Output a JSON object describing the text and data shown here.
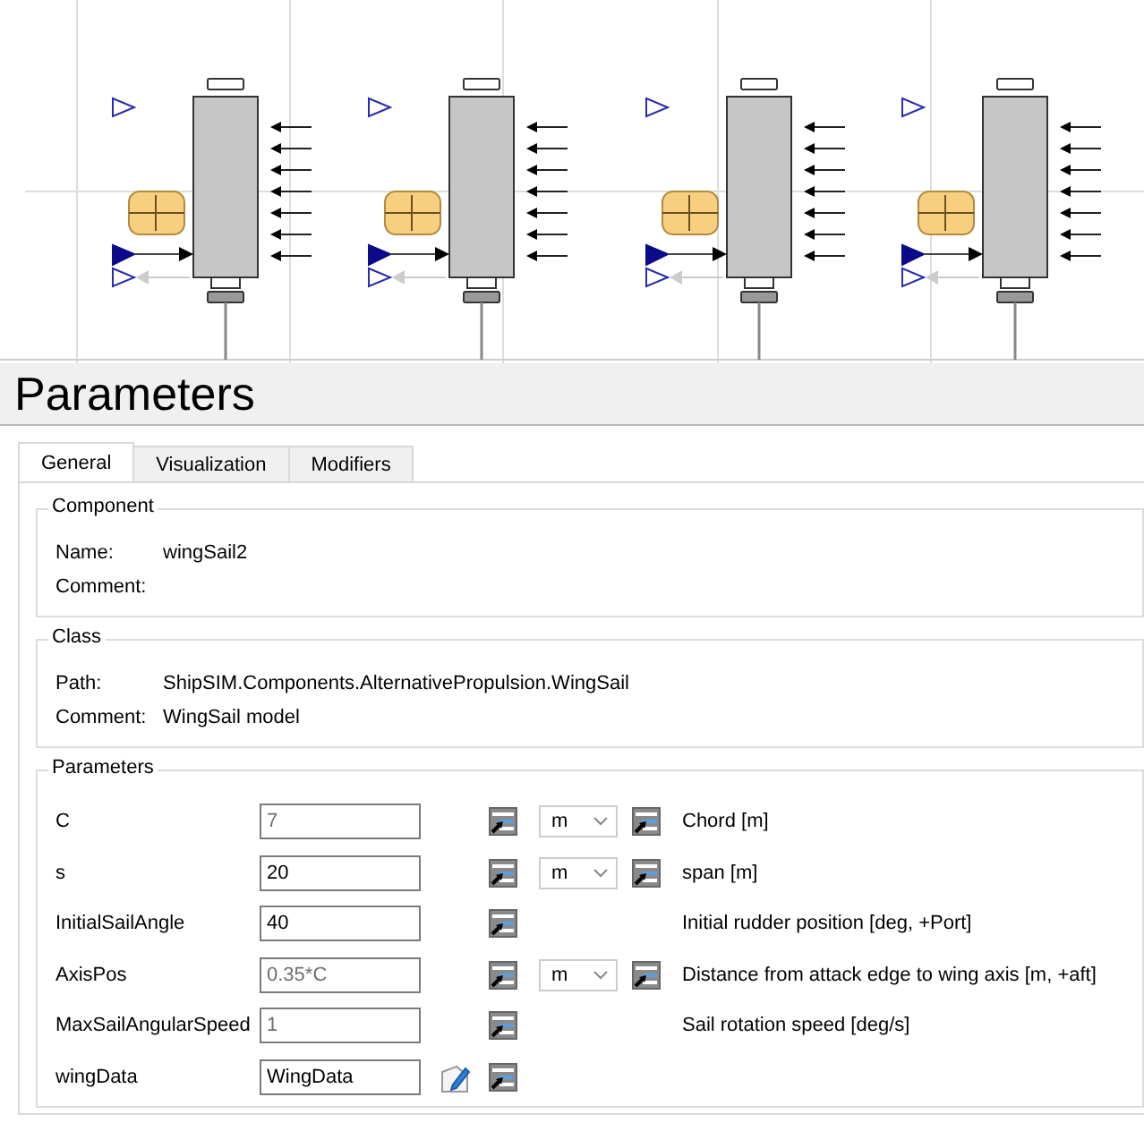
{
  "diagram": {
    "components": [
      {
        "kind": "wing-sail"
      },
      {
        "kind": "wing-sail"
      },
      {
        "kind": "wing-sail"
      },
      {
        "kind": "wing-sail"
      }
    ]
  },
  "title": "Parameters",
  "tabs": [
    {
      "label": "General",
      "selected": true
    },
    {
      "label": "Visualization",
      "selected": false
    },
    {
      "label": "Modifiers",
      "selected": false
    }
  ],
  "component": {
    "heading": "Component",
    "fields": [
      {
        "label": "Name:",
        "value": "wingSail2"
      },
      {
        "label": "Comment:"
      }
    ]
  },
  "class": {
    "heading": "Class",
    "fields": [
      {
        "label": "Path:",
        "value": "ShipSIM.Components.AlternativePropulsion.WingSail"
      },
      {
        "label": "Comment:",
        "value": "WingSail model"
      }
    ]
  },
  "parameters": {
    "heading": "Parameters",
    "rows": [
      {
        "kind": "number",
        "name": "C",
        "value": "7",
        "default": true,
        "unit": "m",
        "description": "Chord [m]"
      },
      {
        "kind": "number",
        "name": "s",
        "value": "20",
        "default": false,
        "unit": "m",
        "description": "span [m]"
      },
      {
        "kind": "number",
        "name": "InitialSailAngle",
        "value": "40",
        "default": false,
        "description": "Initial rudder position [deg, +Port]"
      },
      {
        "kind": "number",
        "name": "AxisPos",
        "value": "0.35*C",
        "default": true,
        "unit": "m",
        "description": "Distance from attack edge to wing axis [m, +aft]"
      },
      {
        "kind": "number",
        "name": "MaxSailAngularSpeed",
        "value": "1",
        "default": true,
        "description": "Sail rotation speed [deg/s]"
      },
      {
        "kind": "record",
        "name": "wingData",
        "value": "WingData",
        "default": false
      }
    ]
  }
}
